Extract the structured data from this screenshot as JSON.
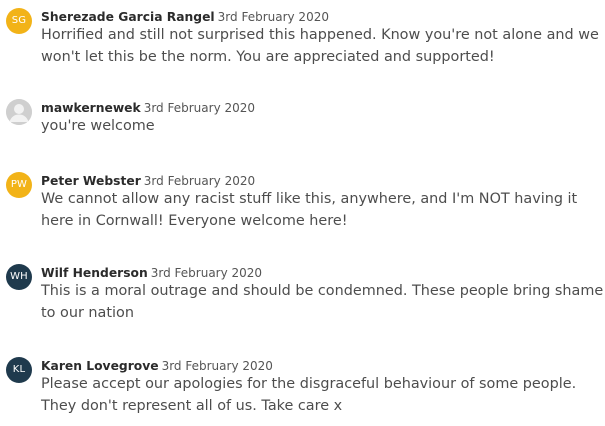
{
  "comments": [
    {
      "initials": "SG",
      "avatar_color": "#f2b318",
      "author": "Sherezade Garcia Rangel",
      "date": "3rd February 2020",
      "text": "Horrified and still not surprised this happened. Know you're not alone and we won't let this be the norm. You are appreciated and supported!"
    },
    {
      "initials": "",
      "avatar_color": "#cfcfcf",
      "avatar_icon": "user-silhouette-icon",
      "author": "mawkernewek",
      "date": "3rd February 2020",
      "text": "you're welcome"
    },
    {
      "initials": "PW",
      "avatar_color": "#f2b318",
      "author": "Peter Webster",
      "date": "3rd February 2020",
      "text": "We cannot allow any racist stuff like this, anywhere, and I'm NOT having it here in Cornwall! Everyone welcome here!"
    },
    {
      "initials": "WH",
      "avatar_color": "#1f3a4d",
      "author": "Wilf Henderson",
      "date": "3rd February 2020",
      "text": "This is a moral outrage and should be condemned. These people bring shame to our nation"
    },
    {
      "initials": "KL",
      "avatar_color": "#1f3a4d",
      "author": "Karen Lovegrove",
      "date": "3rd February 2020",
      "text": "Please accept our apologies for the disgraceful behaviour of some people. They don't represent all of us. Take care x"
    }
  ]
}
